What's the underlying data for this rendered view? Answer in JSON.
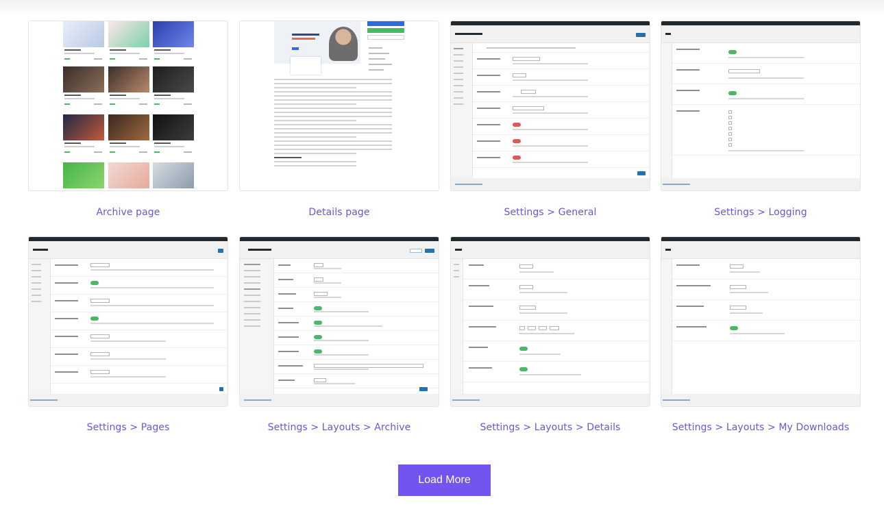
{
  "gallery": {
    "items": [
      {
        "caption": "Archive page"
      },
      {
        "caption": "Details page"
      },
      {
        "caption": "Settings > General"
      },
      {
        "caption": "Settings > Logging"
      },
      {
        "caption": "Settings > Pages"
      },
      {
        "caption": "Settings > Layouts > Archive"
      },
      {
        "caption": "Settings > Layouts > Details"
      },
      {
        "caption": "Settings > Layouts > My Downloads"
      }
    ]
  },
  "load_more": {
    "label": "Load More"
  },
  "colors": {
    "accent": "#7354f0",
    "caption": "#6b55d9",
    "toggle_on": "#4ab866",
    "toggle_off": "#e35454",
    "wp_blue": "#2271b1"
  }
}
